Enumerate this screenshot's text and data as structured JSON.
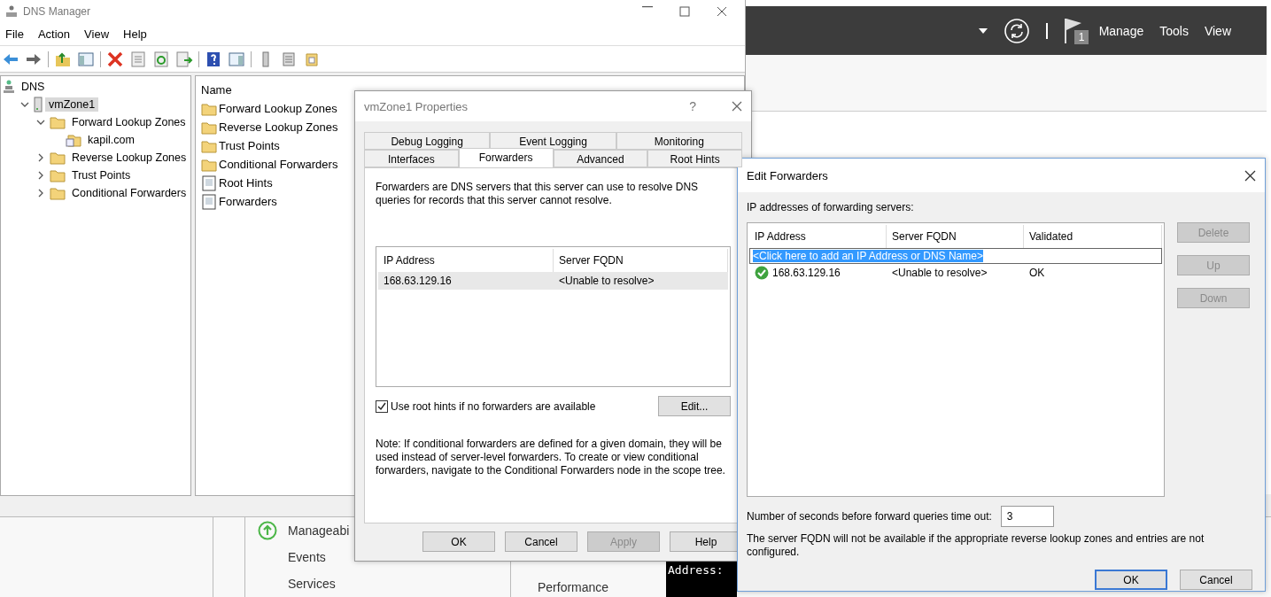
{
  "server_manager": {
    "notification_count": "1",
    "menu": [
      "Manage",
      "Tools",
      "View"
    ],
    "tiles": [
      {
        "label": "Manageabi",
        "kind": "status"
      },
      {
        "label": "Events",
        "kind": "plain"
      },
      {
        "label": "Services",
        "kind": "plain"
      }
    ],
    "tiles_2": [
      {
        "label": "Performance"
      }
    ],
    "console_text": "Address:"
  },
  "dns_manager": {
    "title": "DNS Manager",
    "menu": [
      "File",
      "Action",
      "View",
      "Help"
    ],
    "tree": [
      {
        "label": "DNS",
        "kind": "root",
        "selected": false,
        "children": [
          {
            "label": "vmZone1",
            "kind": "server",
            "selected": true,
            "expanded": true,
            "children": [
              {
                "label": "Forward Lookup Zones",
                "kind": "folder",
                "selected": false,
                "expanded": true,
                "children": [
                  {
                    "label": "kapil.com",
                    "kind": "zone",
                    "selected": false
                  }
                ]
              },
              {
                "label": "Reverse Lookup Zones",
                "kind": "folder",
                "selected": false,
                "expanded": false
              },
              {
                "label": "Trust Points",
                "kind": "folder",
                "selected": false,
                "expanded": false
              },
              {
                "label": "Conditional Forwarders",
                "kind": "folder",
                "selected": false,
                "expanded": false
              }
            ]
          }
        ]
      }
    ],
    "list": {
      "column": "Name",
      "items": [
        {
          "name": "Forward Lookup Zones",
          "kind": "folder"
        },
        {
          "name": "Reverse Lookup Zones",
          "kind": "folder"
        },
        {
          "name": "Trust Points",
          "kind": "folder"
        },
        {
          "name": "Conditional Forwarders",
          "kind": "folder"
        },
        {
          "name": "Root Hints",
          "kind": "record"
        },
        {
          "name": "Forwarders",
          "kind": "record"
        }
      ]
    }
  },
  "properties": {
    "title": "vmZone1 Properties",
    "help": "?",
    "tab_rows": [
      [
        {
          "label": "Debug Logging",
          "selected": false
        },
        {
          "label": "Event Logging",
          "selected": false
        },
        {
          "label": "Monitoring",
          "selected": false
        }
      ],
      [
        {
          "label": "Interfaces",
          "selected": false
        },
        {
          "label": "Forwarders",
          "selected": true
        },
        {
          "label": "Advanced",
          "selected": false
        },
        {
          "label": "Root Hints",
          "selected": false
        }
      ]
    ],
    "description": "Forwarders are DNS servers that this server can use to resolve DNS queries for records that this server cannot resolve.",
    "columns": [
      "IP Address",
      "Server FQDN"
    ],
    "rows": [
      {
        "cells": [
          "168.63.129.16",
          "<Unable to resolve>"
        ],
        "selected": true
      }
    ],
    "root_hints": {
      "label": "Use root hints if no forwarders are available",
      "checked": true
    },
    "edit_button": "Edit...",
    "note": "Note: If conditional forwarders are defined for a given domain, they will be used instead of server-level forwarders.  To create or view conditional forwarders, navigate to the Conditional Forwarders node in the scope tree.",
    "buttons": [
      {
        "label": "OK",
        "disabled": false
      },
      {
        "label": "Cancel",
        "disabled": false
      },
      {
        "label": "Apply",
        "disabled": true
      },
      {
        "label": "Help",
        "disabled": false
      }
    ]
  },
  "edit_forwarders": {
    "title": "Edit Forwarders",
    "list_label": "IP addresses of forwarding servers:",
    "columns": [
      "IP Address",
      "Server FQDN",
      "Validated"
    ],
    "new_entry": "<Click here to add an IP Address or DNS Name>",
    "rows": [
      {
        "ip": "168.63.129.16",
        "fqdn": "<Unable to resolve>",
        "validated": "OK",
        "valid": true
      }
    ],
    "side_buttons": [
      {
        "label": "Delete",
        "disabled": true
      },
      {
        "label": "Up",
        "disabled": true
      },
      {
        "label": "Down",
        "disabled": true
      }
    ],
    "timeout_label": "Number of seconds before forward queries time out:",
    "timeout_value": "3",
    "note": "The server FQDN will not be available if the appropriate reverse lookup zones and entries are not configured.",
    "buttons": [
      {
        "label": "OK",
        "default": true
      },
      {
        "label": "Cancel",
        "default": false
      }
    ]
  }
}
